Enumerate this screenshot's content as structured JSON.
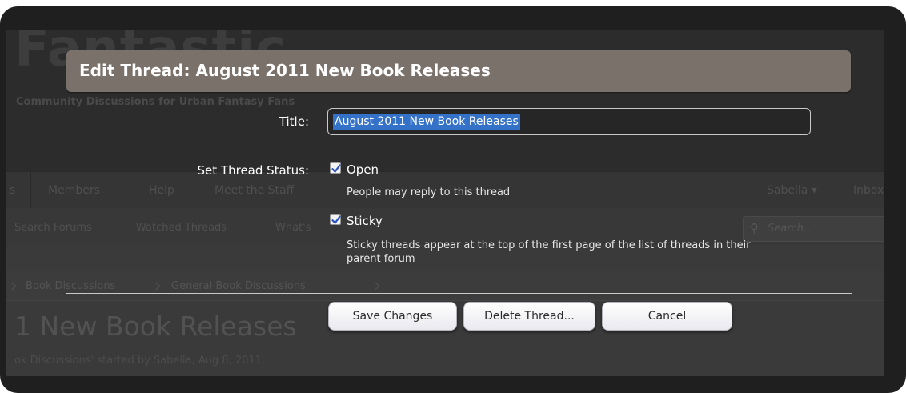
{
  "background": {
    "logo_text": "Fantastic",
    "tagline": "Community Discussions for Urban Fantasy Fans",
    "nav_items": [
      "s",
      "Members",
      "Help",
      "Meet the Staff"
    ],
    "user_nav": {
      "name": "Sabella ▾",
      "inbox": "Inbox"
    },
    "sub_nav": [
      "Search Forums",
      "Watched Threads",
      "What's"
    ],
    "search_placeholder": "Search...",
    "breadcrumbs": [
      "Book Discussions",
      "General Book Discussions"
    ],
    "thread_title": "1 New Book Releases",
    "byline": "ok Discussions' started by Sabella, Aug 8, 2011."
  },
  "dialog": {
    "title": "Edit Thread: August 2011 New Book Releases",
    "title_field": {
      "label": "Title:",
      "value": "August 2011 New Book Releases"
    },
    "status": {
      "label": "Set Thread Status:",
      "options": [
        {
          "label": "Open",
          "checked": true,
          "hint": "People may reply to this thread"
        },
        {
          "label": "Sticky",
          "checked": true,
          "hint": "Sticky threads appear at the top of the first page of the list of threads in their parent forum"
        }
      ]
    },
    "buttons": {
      "save": "Save Changes",
      "delete": "Delete Thread...",
      "cancel": "Cancel"
    }
  },
  "colors": {
    "title_bar": "#7a716a",
    "checkbox_check": "#2a52be",
    "selection": "#3372c8"
  },
  "icons": {
    "checkbox": "checkmark-icon",
    "search": "search-icon",
    "dropdown": "chevron-down-icon"
  }
}
